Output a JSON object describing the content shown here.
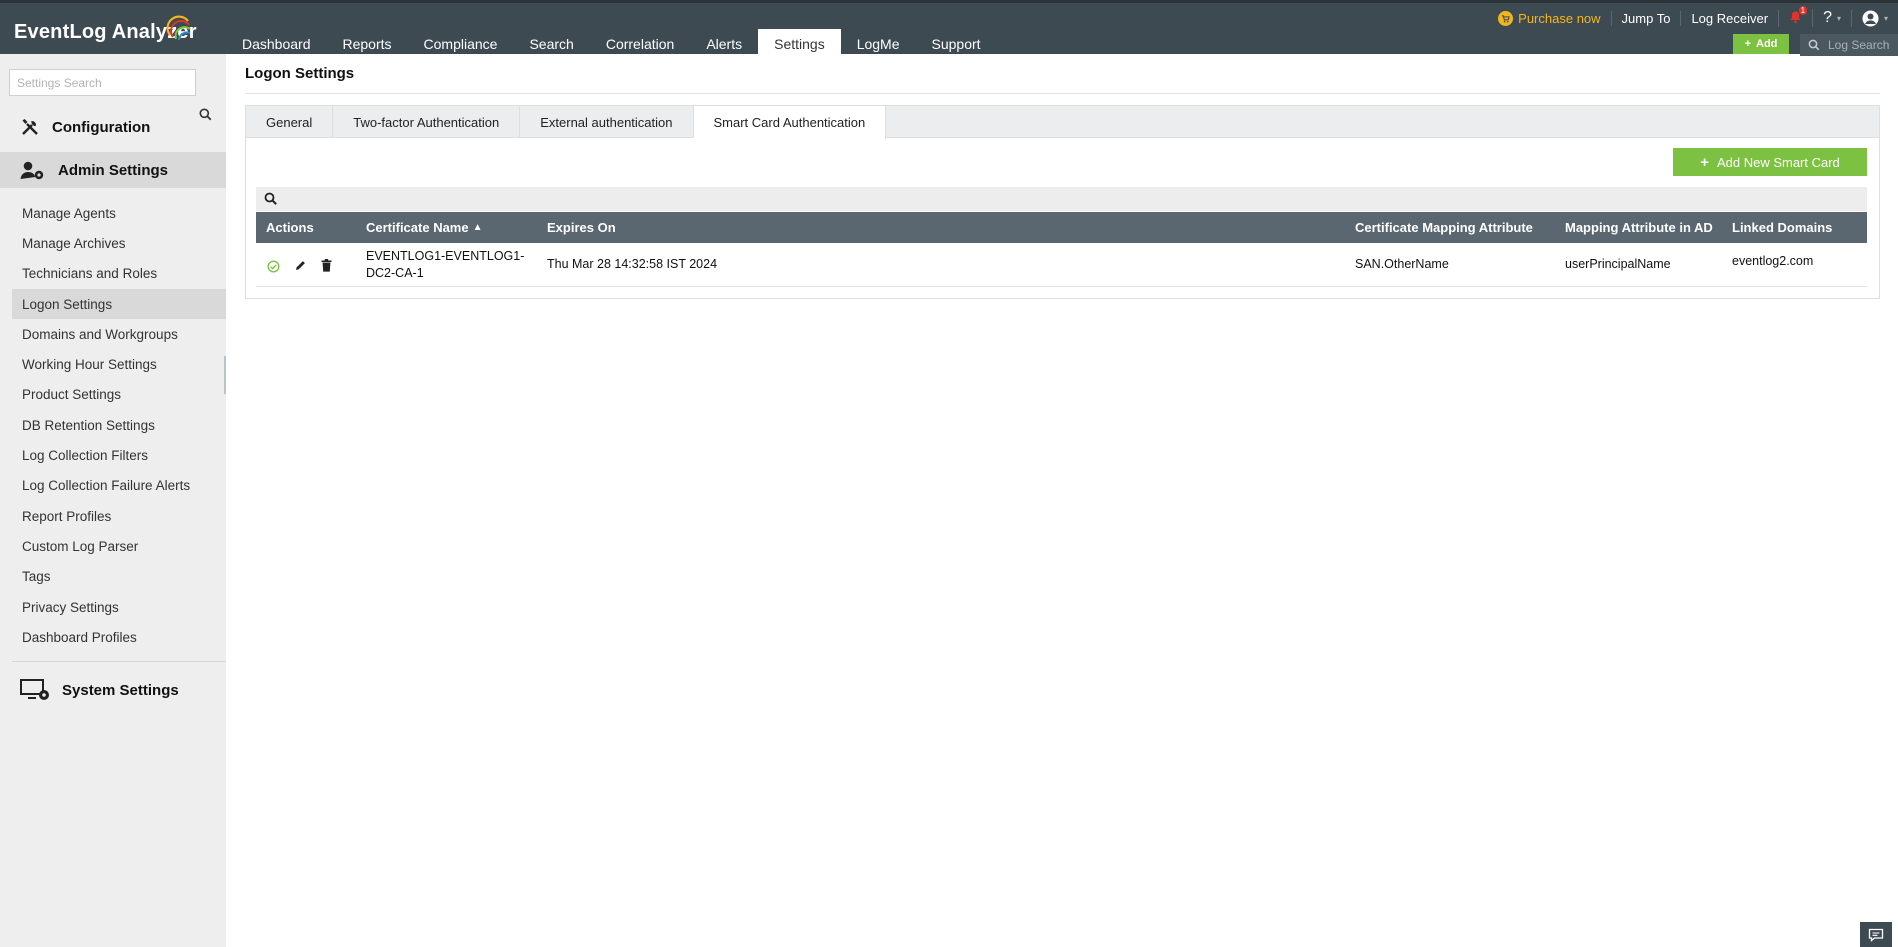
{
  "app": {
    "logo_text": "EventLog Analyzer"
  },
  "nav": {
    "tabs": [
      {
        "label": "Dashboard"
      },
      {
        "label": "Reports"
      },
      {
        "label": "Compliance"
      },
      {
        "label": "Search"
      },
      {
        "label": "Correlation"
      },
      {
        "label": "Alerts"
      },
      {
        "label": "Settings",
        "active": true
      },
      {
        "label": "LogMe"
      },
      {
        "label": "Support"
      }
    ]
  },
  "top_links": {
    "purchase": "Purchase now",
    "jump_to": "Jump To",
    "log_receiver": "Log Receiver",
    "notification_count": "1",
    "help": "?"
  },
  "toolbar": {
    "add_label": "Add",
    "log_search_placeholder": "Log Search"
  },
  "sidebar": {
    "search_placeholder": "Settings Search",
    "configuration": "Configuration",
    "admin_settings": "Admin Settings",
    "system_settings": "System Settings",
    "items": [
      {
        "label": "Manage Agents"
      },
      {
        "label": "Manage Archives"
      },
      {
        "label": "Technicians and Roles"
      },
      {
        "label": "Logon Settings",
        "active": true
      },
      {
        "label": "Domains and Workgroups"
      },
      {
        "label": "Working Hour Settings"
      },
      {
        "label": "Product Settings"
      },
      {
        "label": "DB Retention Settings"
      },
      {
        "label": "Log Collection Filters"
      },
      {
        "label": "Log Collection Failure Alerts"
      },
      {
        "label": "Report Profiles"
      },
      {
        "label": "Custom Log Parser"
      },
      {
        "label": "Tags"
      },
      {
        "label": "Privacy Settings"
      },
      {
        "label": "Dashboard Profiles"
      }
    ]
  },
  "main": {
    "title": "Logon Settings",
    "tabs": [
      {
        "label": "General"
      },
      {
        "label": "Two-factor Authentication"
      },
      {
        "label": "External authentication"
      },
      {
        "label": "Smart Card Authentication",
        "active": true
      }
    ],
    "add_smart_card_label": "Add New Smart Card",
    "table": {
      "headers": {
        "actions": "Actions",
        "certificate_name": "Certificate Name",
        "expires_on": "Expires On",
        "mapping_attribute": "Certificate Mapping Attribute",
        "mapping_attribute_ad": "Mapping Attribute in AD",
        "linked_domains": "Linked Domains"
      },
      "rows": [
        {
          "certificate_name_line1": "EVENTLOG1-EVENTLOG1-",
          "certificate_name_line2": "DC2-CA-1",
          "expires_on": "Thu Mar 28 14:32:58 IST 2024",
          "mapping_attribute": "SAN.OtherName",
          "mapping_attribute_ad": "userPrincipalName",
          "linked_domains": "eventlog2.com"
        }
      ]
    }
  },
  "colors": {
    "topbar": "#3e4a52",
    "accent_green": "#7dc142",
    "purchase_yellow": "#f3b51c",
    "table_header": "#5a6770"
  }
}
